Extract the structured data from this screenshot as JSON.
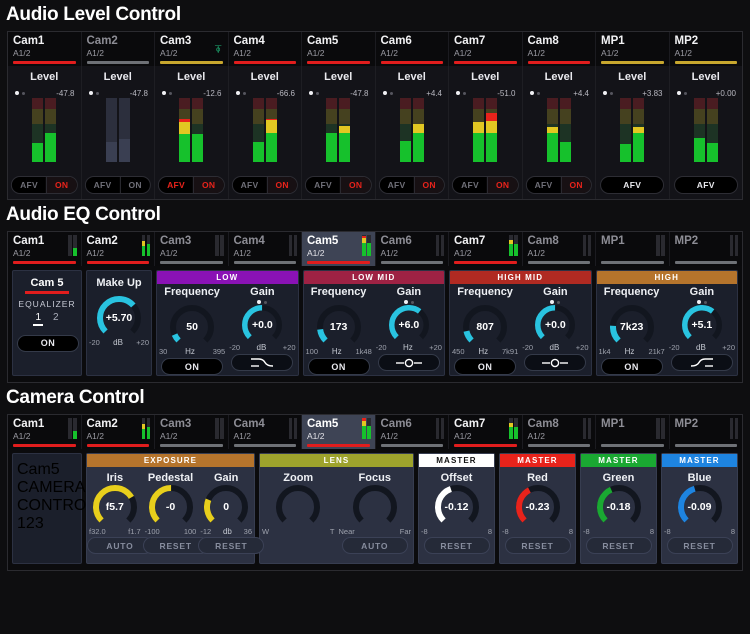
{
  "sections": {
    "audio_level": {
      "title": "Audio Level Control"
    },
    "audio_eq": {
      "title": "Audio EQ Control"
    },
    "camera": {
      "title": "Camera Control"
    }
  },
  "colors": {
    "tally_red": "#e11d1d",
    "tally_yellow": "#c8a72e",
    "tally_gray": "#6e7176",
    "meter_green": "#16c12c",
    "meter_yellow": "#e2c722",
    "meter_red": "#e8231b",
    "knob_cyan": "#29c3e0",
    "knob_yellow": "#e8cf1c",
    "band_low": "#8a12b5",
    "band_low_mid": "#9e2244",
    "band_high_mid": "#b02a22",
    "band_high": "#b5742c",
    "master_offset": "#ffffff",
    "master_red": "#e8231b",
    "master_green": "#1aa832",
    "master_blue": "#1e84e0",
    "lens": "#9ea32c",
    "exposure": "#b5742c"
  },
  "audio_level": {
    "channels": [
      {
        "name": "Cam1",
        "sub": "A1/2",
        "tally": "red",
        "headphone": false,
        "level_title": "Level",
        "value": "-47.8",
        "dot_on": true,
        "meters": [
          {
            "green": 30,
            "yellow": 0,
            "red": 0
          },
          {
            "green": 46,
            "yellow": 0,
            "red": 0
          }
        ],
        "muted": false,
        "buttons": {
          "afv": "AFV",
          "on": "ON",
          "afv_active": false,
          "on_active": true,
          "single": false
        }
      },
      {
        "name": "Cam2",
        "sub": "A1/2",
        "tally": "gray",
        "headphone": false,
        "level_title": "Level",
        "value": "-47.8",
        "dot_on": true,
        "meters": [
          {
            "green": 32,
            "yellow": 0,
            "red": 0
          },
          {
            "green": 36,
            "yellow": 0,
            "red": 0
          }
        ],
        "muted": true,
        "buttons": {
          "afv": "AFV",
          "on": "ON",
          "afv_active": false,
          "on_active": false,
          "single": false
        }
      },
      {
        "name": "Cam3",
        "sub": "A1/2",
        "tally": "yellow",
        "headphone": true,
        "level_title": "Level",
        "value": "-12.6",
        "dot_on": true,
        "meters": [
          {
            "green": 44,
            "yellow": 18,
            "red": 6
          },
          {
            "green": 44,
            "yellow": 0,
            "red": 0
          }
        ],
        "muted": false,
        "buttons": {
          "afv": "AFV",
          "on": "ON",
          "afv_active": true,
          "on_active": true,
          "single": false
        }
      },
      {
        "name": "Cam4",
        "sub": "A1/2",
        "tally": "red",
        "headphone": false,
        "level_title": "Level",
        "value": "-66.6",
        "dot_on": true,
        "meters": [
          {
            "green": 31,
            "yellow": 0,
            "red": 0
          },
          {
            "green": 46,
            "yellow": 19,
            "red": 3
          }
        ],
        "muted": false,
        "buttons": {
          "afv": "AFV",
          "on": "ON",
          "afv_active": false,
          "on_active": true,
          "single": false
        }
      },
      {
        "name": "Cam5",
        "sub": "A1/2",
        "tally": "red",
        "headphone": false,
        "level_title": "Level",
        "value": "-47.8",
        "dot_on": true,
        "meters": [
          {
            "green": 46,
            "yellow": 0,
            "red": 0
          },
          {
            "green": 46,
            "yellow": 10,
            "red": 0
          }
        ],
        "muted": false,
        "buttons": {
          "afv": "AFV",
          "on": "ON",
          "afv_active": false,
          "on_active": true,
          "single": false
        }
      },
      {
        "name": "Cam6",
        "sub": "A1/2",
        "tally": "red",
        "headphone": false,
        "level_title": "Level",
        "value": "+4.4",
        "dot_on": true,
        "meters": [
          {
            "green": 33,
            "yellow": 0,
            "red": 0
          },
          {
            "green": 46,
            "yellow": 14,
            "red": 0
          }
        ],
        "muted": false,
        "buttons": {
          "afv": "AFV",
          "on": "ON",
          "afv_active": false,
          "on_active": true,
          "single": false
        }
      },
      {
        "name": "Cam7",
        "sub": "A1/2",
        "tally": "red",
        "headphone": false,
        "level_title": "Level",
        "value": "-51.0",
        "dot_on": true,
        "meters": [
          {
            "green": 46,
            "yellow": 16,
            "red": 0
          },
          {
            "green": 46,
            "yellow": 18,
            "red": 12
          }
        ],
        "muted": false,
        "buttons": {
          "afv": "AFV",
          "on": "ON",
          "afv_active": false,
          "on_active": true,
          "single": false
        }
      },
      {
        "name": "Cam8",
        "sub": "A1/2",
        "tally": "red",
        "headphone": false,
        "level_title": "Level",
        "value": "+4.4",
        "dot_on": true,
        "meters": [
          {
            "green": 46,
            "yellow": 8,
            "red": 0
          },
          {
            "green": 32,
            "yellow": 0,
            "red": 0
          }
        ],
        "muted": false,
        "buttons": {
          "afv": "AFV",
          "on": "ON",
          "afv_active": false,
          "on_active": true,
          "single": false
        }
      },
      {
        "name": "MP1",
        "sub": "A1/2",
        "tally": "yellow",
        "headphone": false,
        "level_title": "Level",
        "value": "+3.83",
        "dot_on": true,
        "meters": [
          {
            "green": 28,
            "yellow": 0,
            "red": 0
          },
          {
            "green": 46,
            "yellow": 9,
            "red": 0
          }
        ],
        "muted": false,
        "buttons": {
          "afv": "AFV",
          "on": "",
          "afv_active": false,
          "on_active": false,
          "single": true
        }
      },
      {
        "name": "MP2",
        "sub": "A1/2",
        "tally": "yellow",
        "headphone": false,
        "level_title": "Level",
        "value": "+0.00",
        "dot_on": true,
        "meters": [
          {
            "green": 38,
            "yellow": 0,
            "red": 0
          },
          {
            "green": 30,
            "yellow": 0,
            "red": 0
          }
        ],
        "muted": false,
        "buttons": {
          "afv": "AFV",
          "on": "",
          "afv_active": false,
          "on_active": false,
          "single": true
        }
      }
    ]
  },
  "audio_eq": {
    "channels": [
      {
        "name": "Cam1",
        "sub": "A1/2",
        "tally": "red",
        "selected": false,
        "meters": [
          {
            "green": 0,
            "yellow": 0,
            "red": 0
          },
          {
            "green": 40,
            "yellow": 0,
            "red": 0
          }
        ]
      },
      {
        "name": "Cam2",
        "sub": "A1/2",
        "tally": "red",
        "selected": false,
        "meters": [
          {
            "green": 50,
            "yellow": 20,
            "red": 0
          },
          {
            "green": 55,
            "yellow": 0,
            "red": 0
          }
        ]
      },
      {
        "name": "Cam3",
        "sub": "A1/2",
        "tally": "gray",
        "selected": false,
        "meters": [
          {
            "green": 0,
            "yellow": 0,
            "red": 0
          },
          {
            "green": 0,
            "yellow": 0,
            "red": 0
          }
        ]
      },
      {
        "name": "Cam4",
        "sub": "A1/2",
        "tally": "gray",
        "selected": false,
        "meters": [
          {
            "green": 0,
            "yellow": 0,
            "red": 0
          },
          {
            "green": 0,
            "yellow": 0,
            "red": 0
          }
        ]
      },
      {
        "name": "Cam5",
        "sub": "A1/2",
        "tally": "red",
        "selected": true,
        "meters": [
          {
            "green": 60,
            "yellow": 25,
            "red": 12
          },
          {
            "green": 60,
            "yellow": 0,
            "red": 0
          }
        ]
      },
      {
        "name": "Cam6",
        "sub": "A1/2",
        "tally": "gray",
        "selected": false,
        "meters": [
          {
            "green": 0,
            "yellow": 0,
            "red": 0
          },
          {
            "green": 0,
            "yellow": 0,
            "red": 0
          }
        ]
      },
      {
        "name": "Cam7",
        "sub": "A1/2",
        "tally": "red",
        "selected": false,
        "meters": [
          {
            "green": 55,
            "yellow": 22,
            "red": 0
          },
          {
            "green": 58,
            "yellow": 0,
            "red": 0
          }
        ]
      },
      {
        "name": "Cam8",
        "sub": "A1/2",
        "tally": "gray",
        "selected": false,
        "meters": [
          {
            "green": 0,
            "yellow": 0,
            "red": 0
          },
          {
            "green": 0,
            "yellow": 0,
            "red": 0
          }
        ]
      },
      {
        "name": "MP1",
        "sub": "",
        "tally": "gray",
        "selected": false,
        "meters": [
          {
            "green": 0,
            "yellow": 0,
            "red": 0
          },
          {
            "green": 0,
            "yellow": 0,
            "red": 0
          }
        ]
      },
      {
        "name": "MP2",
        "sub": "",
        "tally": "gray",
        "selected": false,
        "meters": [
          {
            "green": 0,
            "yellow": 0,
            "red": 0
          },
          {
            "green": 0,
            "yellow": 0,
            "red": 0
          }
        ]
      }
    ],
    "left_panel": {
      "cam_label": "Cam 5",
      "mode_name": "EQUALIZER",
      "pages": [
        "1",
        "2"
      ],
      "active_page": "1",
      "on_button": "ON"
    },
    "make_up": {
      "label": "Make Up",
      "value": "+5.70",
      "min": "-20",
      "unit": "dB",
      "max": "+20",
      "arc_pct": 68
    },
    "bands": [
      {
        "id": "low",
        "header": "LOW",
        "header_color": "#8a12b5",
        "frequency": {
          "label": "Frequency",
          "value": "50",
          "min": "30",
          "unit": "Hz",
          "max": "395",
          "arc_pct": 8,
          "on_button": "ON",
          "on": true
        },
        "gain": {
          "label": "Gain",
          "value": "+0.0",
          "min": "-20",
          "unit": "dB",
          "max": "+20",
          "arc_pct": 50,
          "shape_icon": "low-shelf-icon",
          "dots": [
            true,
            false
          ]
        }
      },
      {
        "id": "low_mid",
        "header": "LOW MID",
        "header_color": "#9e2244",
        "frequency": {
          "label": "Frequency",
          "value": "173",
          "min": "100",
          "unit": "Hz",
          "max": "1k48",
          "arc_pct": 14,
          "on_button": "ON",
          "on": true
        },
        "gain": {
          "label": "Gain",
          "value": "+6.0",
          "min": "-20",
          "unit": "Hz",
          "max": "+20",
          "arc_pct": 64,
          "shape_icon": "bell-icon",
          "dots": [
            true,
            false
          ]
        }
      },
      {
        "id": "high_mid",
        "header": "HIGH MID",
        "header_color": "#b02a22",
        "frequency": {
          "label": "Frequency",
          "value": "807",
          "min": "450",
          "unit": "Hz",
          "max": "7k91",
          "arc_pct": 12,
          "on_button": "ON",
          "on": true
        },
        "gain": {
          "label": "Gain",
          "value": "+0.0",
          "min": "-20",
          "unit": "dB",
          "max": "+20",
          "arc_pct": 50,
          "shape_icon": "bell-icon",
          "dots": [
            true,
            false
          ]
        }
      },
      {
        "id": "high",
        "header": "HIGH",
        "header_color": "#b5742c",
        "frequency": {
          "label": "Frequency",
          "value": "7k23",
          "min": "1k4",
          "unit": "Hz",
          "max": "21k7",
          "arc_pct": 18,
          "on_button": "ON",
          "on": true
        },
        "gain": {
          "label": "Gain",
          "value": "+5.1",
          "min": "-20",
          "unit": "dB",
          "max": "+20",
          "arc_pct": 64,
          "shape_icon": "high-shelf-icon",
          "dots": [
            true,
            false
          ]
        }
      }
    ]
  },
  "camera": {
    "channels": [
      {
        "name": "Cam1",
        "sub": "A1/2",
        "tally": "red",
        "selected": false,
        "meters": [
          {
            "green": 0,
            "yellow": 0,
            "red": 0
          },
          {
            "green": 38,
            "yellow": 0,
            "red": 0
          }
        ]
      },
      {
        "name": "Cam2",
        "sub": "A1/2",
        "tally": "red",
        "selected": false,
        "meters": [
          {
            "green": 50,
            "yellow": 22,
            "red": 0
          },
          {
            "green": 55,
            "yellow": 0,
            "red": 0
          }
        ]
      },
      {
        "name": "Cam3",
        "sub": "A1/2",
        "tally": "gray",
        "selected": false,
        "meters": [
          {
            "green": 0,
            "yellow": 0,
            "red": 0
          },
          {
            "green": 0,
            "yellow": 0,
            "red": 0
          }
        ]
      },
      {
        "name": "Cam4",
        "sub": "A1/2",
        "tally": "gray",
        "selected": false,
        "meters": [
          {
            "green": 0,
            "yellow": 0,
            "red": 0
          },
          {
            "green": 0,
            "yellow": 0,
            "red": 0
          }
        ]
      },
      {
        "name": "Cam5",
        "sub": "A1/2",
        "tally": "red",
        "selected": true,
        "meters": [
          {
            "green": 60,
            "yellow": 26,
            "red": 12
          },
          {
            "green": 60,
            "yellow": 0,
            "red": 0
          }
        ]
      },
      {
        "name": "Cam6",
        "sub": "A1/2",
        "tally": "gray",
        "selected": false,
        "meters": [
          {
            "green": 0,
            "yellow": 0,
            "red": 0
          },
          {
            "green": 0,
            "yellow": 0,
            "red": 0
          }
        ]
      },
      {
        "name": "Cam7",
        "sub": "A1/2",
        "tally": "red",
        "selected": false,
        "meters": [
          {
            "green": 55,
            "yellow": 22,
            "red": 0
          },
          {
            "green": 58,
            "yellow": 0,
            "red": 0
          }
        ]
      },
      {
        "name": "Cam8",
        "sub": "A1/2",
        "tally": "gray",
        "selected": false,
        "meters": [
          {
            "green": 0,
            "yellow": 0,
            "red": 0
          },
          {
            "green": 0,
            "yellow": 0,
            "red": 0
          }
        ]
      },
      {
        "name": "MP1",
        "sub": "",
        "tally": "gray",
        "selected": false,
        "meters": [
          {
            "green": 0,
            "yellow": 0,
            "red": 0
          },
          {
            "green": 0,
            "yellow": 0,
            "red": 0
          }
        ]
      },
      {
        "name": "MP2",
        "sub": "",
        "tally": "gray",
        "selected": false,
        "meters": [
          {
            "green": 0,
            "yellow": 0,
            "red": 0
          },
          {
            "green": 0,
            "yellow": 0,
            "red": 0
          }
        ]
      }
    ],
    "left_panel": {
      "cam_label": "Cam5",
      "mode_line1": "CAMERA",
      "mode_line2": "CONTROL",
      "pages": [
        "1",
        "2",
        "3"
      ],
      "active_page": "1"
    },
    "exposure": {
      "header": "EXPOSURE",
      "header_color": "#b5742c",
      "knobs": [
        {
          "label": "Iris",
          "value": "f5.7",
          "min": "f32.0",
          "unit": "",
          "max": "f1.7",
          "arc_pct": 72,
          "color": "#e8cf1c",
          "button": "AUTO"
        },
        {
          "label": "Pedestal",
          "value": "-0",
          "min": "-100",
          "unit": "",
          "max": "100",
          "arc_pct": 50,
          "color": "#e8cf1c",
          "button": "RESET"
        },
        {
          "label": "Gain",
          "value": "0",
          "min": "-12",
          "unit": "db",
          "max": "36",
          "arc_pct": 25,
          "color": "#e8cf1c",
          "button": "RESET"
        }
      ]
    },
    "lens": {
      "header": "LENS",
      "header_color": "#9ea32c",
      "knobs": [
        {
          "label": "Zoom",
          "value": "",
          "min": "W",
          "unit": "",
          "max": "T",
          "arc_pct": 0,
          "color": "#e8cf1c",
          "button": ""
        },
        {
          "label": "Focus",
          "value": "",
          "min": "Near",
          "unit": "",
          "max": "Far",
          "arc_pct": 0,
          "color": "#e8cf1c",
          "button": "AUTO"
        }
      ]
    },
    "masters": [
      {
        "header": "MASTER",
        "header_color": "#ffffff",
        "header_text_color": "#101010",
        "label": "Offset",
        "value": "-0.12",
        "min": "-8",
        "max": "8",
        "arc_pct": 43,
        "color": "#ffffff",
        "button": "RESET"
      },
      {
        "header": "MASTER",
        "header_color": "#e8231b",
        "header_text_color": "#ffffff",
        "label": "Red",
        "value": "-0.23",
        "min": "-8",
        "max": "8",
        "arc_pct": 40,
        "color": "#e8231b",
        "button": "RESET"
      },
      {
        "header": "MASTER",
        "header_color": "#1aa832",
        "header_text_color": "#ffffff",
        "label": "Green",
        "value": "-0.18",
        "min": "-8",
        "max": "8",
        "arc_pct": 41,
        "color": "#1aa832",
        "button": "RESET"
      },
      {
        "header": "MASTER",
        "header_color": "#1e84e0",
        "header_text_color": "#ffffff",
        "label": "Blue",
        "value": "-0.09",
        "min": "-8",
        "max": "8",
        "arc_pct": 44,
        "color": "#1e84e0",
        "button": "RESET"
      }
    ]
  }
}
